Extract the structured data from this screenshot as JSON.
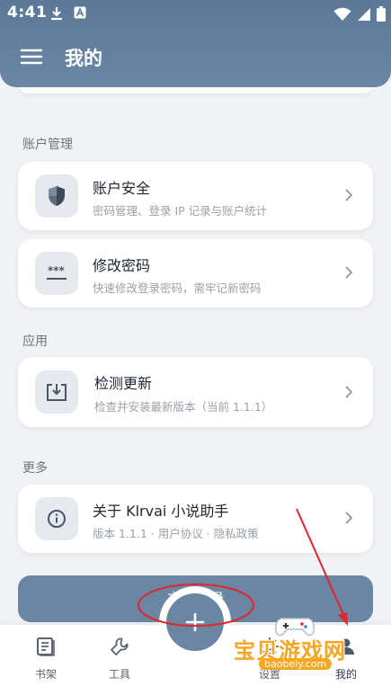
{
  "status_bar": {
    "time": "4:41"
  },
  "header": {
    "title": "我的"
  },
  "sections": {
    "account": {
      "label": "账户管理",
      "items": [
        {
          "title": "账户安全",
          "subtitle": "密码管理、登录 IP 记录与账户统计",
          "icon": "shield-icon"
        },
        {
          "title": "修改密码",
          "subtitle": "快速修改登录密码，需牢记新密码",
          "icon": "password-icon"
        }
      ]
    },
    "app": {
      "label": "应用",
      "items": [
        {
          "title": "检测更新",
          "subtitle": "检查并安装最新版本（当前 1.1.1）",
          "icon": "download-icon"
        }
      ]
    },
    "more": {
      "label": "更多",
      "items": [
        {
          "title": "关于 Klrvai 小说助手",
          "subtitle": "版本 1.1.1 · 用户协议 · 隐私政策",
          "icon": "info-icon"
        }
      ]
    }
  },
  "login_button": {
    "label": "立即登录"
  },
  "bottom_nav": {
    "items": [
      {
        "label": "书架",
        "icon": "book-icon"
      },
      {
        "label": "工具",
        "icon": "wrench-icon"
      },
      {
        "label": "设置",
        "icon": "settings-icon"
      },
      {
        "label": "我的",
        "icon": "person-icon"
      }
    ],
    "fab_icon": "plus-icon"
  },
  "watermark": {
    "text": "宝贝游戏网",
    "sub": "baobeiy.com"
  },
  "colors": {
    "header": "#5b7896",
    "accent": "#6a86a3",
    "annotation": "#e0262b",
    "watermark": "#f5a623"
  }
}
